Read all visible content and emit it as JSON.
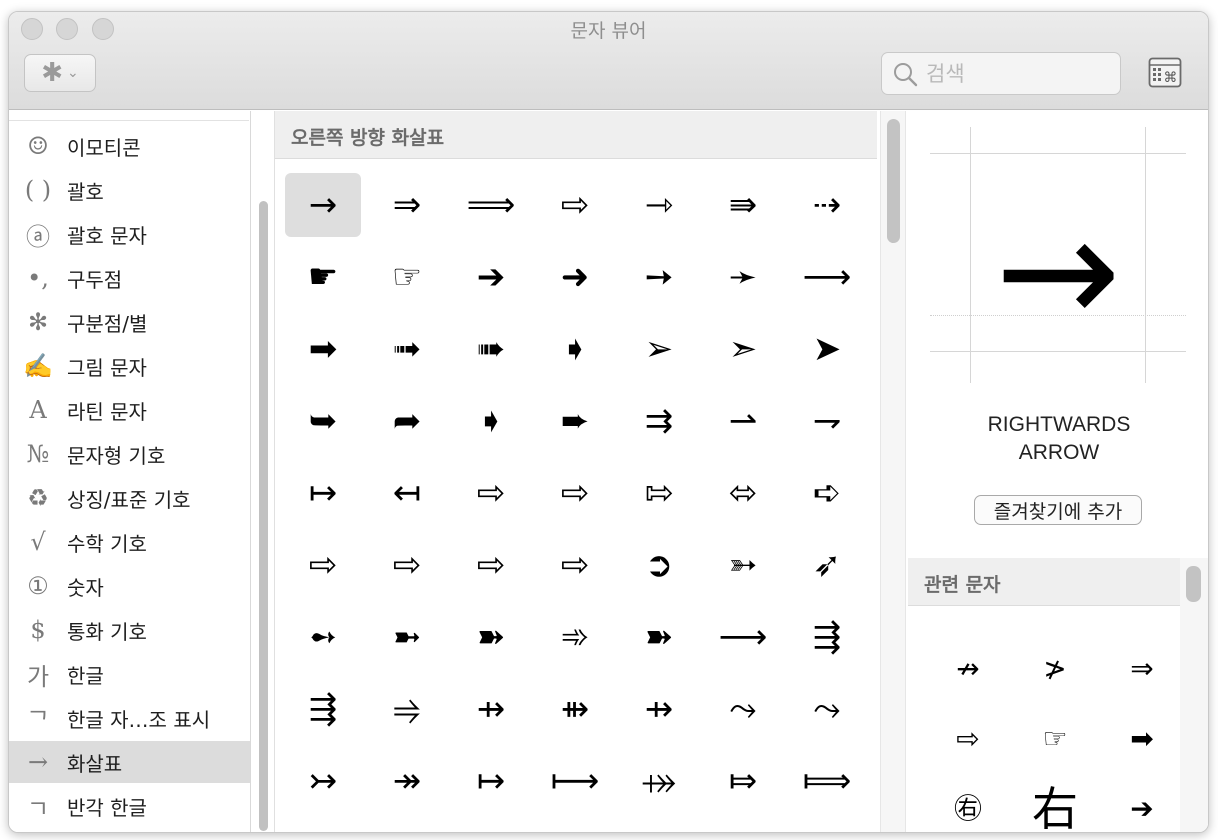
{
  "window": {
    "title": "문자 뷰어"
  },
  "toolbar": {
    "gear_icon": "gear-icon",
    "gear_glyph": "✱",
    "chevron_glyph": "⌄",
    "search_placeholder": "검색",
    "search_value": "",
    "keyboard_viewer_icon": "keyboard-viewer-icon"
  },
  "sidebar": {
    "items": [
      {
        "icon": "☺",
        "label": "이모티콘",
        "selected": false
      },
      {
        "icon": "( )",
        "label": "괄호",
        "selected": false
      },
      {
        "icon": "ⓐ",
        "label": "괄호 문자",
        "selected": false
      },
      {
        "icon": "•,",
        "label": "구두점",
        "selected": false
      },
      {
        "icon": "✻",
        "label": "구분점/별",
        "selected": false
      },
      {
        "icon": "✍",
        "label": "그림 문자",
        "selected": false
      },
      {
        "icon": "A",
        "label": "라틴 문자",
        "selected": false
      },
      {
        "icon": "№",
        "label": "문자형 기호",
        "selected": false
      },
      {
        "icon": "♻",
        "label": "상징/표준 기호",
        "selected": false
      },
      {
        "icon": "√",
        "label": "수학 기호",
        "selected": false
      },
      {
        "icon": "①",
        "label": "숫자",
        "selected": false
      },
      {
        "icon": "$",
        "label": "통화 기호",
        "selected": false
      },
      {
        "icon": "가",
        "label": "한글",
        "selected": false
      },
      {
        "icon": "ᄀ",
        "label": "한글 자…조 표시",
        "selected": false
      },
      {
        "icon": "→",
        "label": "화살표",
        "selected": true
      },
      {
        "icon": "ﾡ",
        "label": "반각 한글",
        "selected": false
      }
    ]
  },
  "grid": {
    "header": "오른쪽 방향 화살표",
    "selected_index": 0,
    "chars": [
      "→",
      "⇒",
      "⟹",
      "⇨",
      "⇾",
      "⇛",
      "⇢",
      "☛",
      "☞",
      "➔",
      "➜",
      "➙",
      "➛",
      "⟶",
      "➡",
      "➟",
      "➠",
      "➧",
      "➢",
      "➣",
      "➤",
      "➥",
      "➦",
      "➧",
      "➨",
      "⇉",
      "⇀",
      "⇁",
      "↦",
      "↤",
      "⇨",
      "⇨",
      "⇰",
      "⬄",
      "➪",
      "⇨",
      "⇨",
      "⇨",
      "⇨",
      "➲",
      "➳",
      "➶",
      "➻",
      "➼",
      "➽",
      "➾",
      "➽",
      "⟶",
      "⇶",
      "⇶",
      "⥤",
      "⇸",
      "⇻",
      "⇸",
      "⤳",
      "⤳",
      "↣",
      "↠",
      "↦",
      "⟼",
      "⤀",
      "⤇",
      "⟾"
    ]
  },
  "detail": {
    "glyph": "→",
    "name_line1": "RIGHTWARDS",
    "name_line2": "ARROW",
    "favorite_button": "즐겨찾기에 추가",
    "related_header": "관련 문자",
    "related": [
      "↛",
      "≯",
      "⇒",
      "⇨",
      "☞",
      "➡",
      "㊨",
      "右",
      "➔"
    ]
  },
  "colors": {
    "selection": "#dcdcdc",
    "header_bg": "#efefef"
  }
}
